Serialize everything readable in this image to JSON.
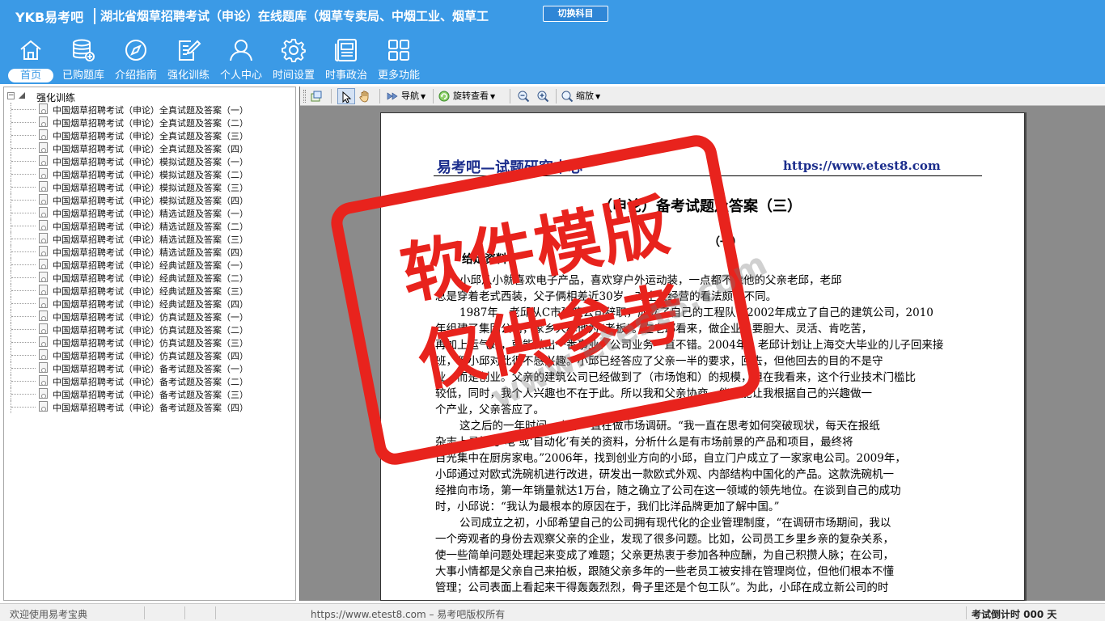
{
  "header": {
    "logo": "YKB易考吧",
    "title": "湖北省烟草招聘考试（申论）在线题库（烟草专卖局、中烟工业、烟草工",
    "switch_label": "切换科目"
  },
  "toolbar": [
    {
      "label": "首页",
      "icon": "home-icon",
      "active": true
    },
    {
      "label": "已购题库",
      "icon": "database-add-icon",
      "active": false
    },
    {
      "label": "介绍指南",
      "icon": "compass-icon",
      "active": false
    },
    {
      "label": "强化训练",
      "icon": "edit-document-icon",
      "active": false
    },
    {
      "label": "个人中心",
      "icon": "user-icon",
      "active": false
    },
    {
      "label": "时间设置",
      "icon": "gear-icon",
      "active": false
    },
    {
      "label": "时事政治",
      "icon": "news-icon",
      "active": false
    },
    {
      "label": "更多功能",
      "icon": "grid-icon",
      "active": false
    }
  ],
  "tree": {
    "root_label": "强化训练",
    "items": [
      "中国烟草招聘考试（申论）全真试题及答案（一）",
      "中国烟草招聘考试（申论）全真试题及答案（二）",
      "中国烟草招聘考试（申论）全真试题及答案（三）",
      "中国烟草招聘考试（申论）全真试题及答案（四）",
      "中国烟草招聘考试（申论）模拟试题及答案（一）",
      "中国烟草招聘考试（申论）模拟试题及答案（二）",
      "中国烟草招聘考试（申论）模拟试题及答案（三）",
      "中国烟草招聘考试（申论）模拟试题及答案（四）",
      "中国烟草招聘考试（申论）精选试题及答案（一）",
      "中国烟草招聘考试（申论）精选试题及答案（二）",
      "中国烟草招聘考试（申论）精选试题及答案（三）",
      "中国烟草招聘考试（申论）精选试题及答案（四）",
      "中国烟草招聘考试（申论）经典试题及答案（一）",
      "中国烟草招聘考试（申论）经典试题及答案（二）",
      "中国烟草招聘考试（申论）经典试题及答案（三）",
      "中国烟草招聘考试（申论）经典试题及答案（四）",
      "中国烟草招聘考试（申论）仿真试题及答案（一）",
      "中国烟草招聘考试（申论）仿真试题及答案（二）",
      "中国烟草招聘考试（申论）仿真试题及答案（三）",
      "中国烟草招聘考试（申论）仿真试题及答案（四）",
      "中国烟草招聘考试（申论）备考试题及答案（一）",
      "中国烟草招聘考试（申论）备考试题及答案（二）",
      "中国烟草招聘考试（申论）备考试题及答案（三）",
      "中国烟草招聘考试（申论）备考试题及答案（四）"
    ]
  },
  "viewer_toolbar": {
    "nav_label": "导航",
    "rotate_label": "旋转查看",
    "zoom_label": "缩放"
  },
  "document": {
    "header_left": "易考吧—试题研究中心",
    "header_right": "https://www.etest8.com",
    "title": "（申论）备考试题及答案（三）",
    "subtitle": "（一）",
    "section_head": "给定资料",
    "lines": [
      "小邱从小就喜欢电子产品，喜欢穿户外运动装，一点都不像他的父亲老邱，老邱",
      "总是穿着老式西装，父子俩相差近30岁，对企业经营的看法颇有不同。",
      "1987年，老邱从C市建筑公司辞职，成立了自己的工程队，2002年成立了自己的建筑公司，2010",
      "年组建了集团公司，家乡人称他为“老板”。在老邱看来，做企业只要胆大、灵活、肯吃苦，",
      "再加上运气好，就能做出一番事业。公司业务一直不错。2004年，老邱计划让上海交大毕业的儿子回来接",
      "班，但小邱对此很不感兴趣。小邱已经答应了父亲一半的要求，回去，但他回去的目的不是守",
      "业，而是创业。父亲的建筑公司已经做到了（市场饱和）的规模，但在我看来，这个行业技术门槛比",
      "较低，同时，我个人兴趣也不在于此。所以我和父亲协商，能不能让我根据自己的兴趣做一",
      "个产业，父亲答应了。",
      "这之后的一年时间，小邱一直在做市场调研。“我一直在思考如何突破现状，每天在报纸",
      "杂志上寻找与‘电’或‘自动化’有关的资料，分析什么是有市场前景的产品和项目，最终将",
      "目光集中在厨房家电。”2006年，找到创业方向的小邱，自立门户成立了一家家电公司。2009年，",
      "小邱通过对欧式洗碗机进行改进，研发出一款欧式外观、内部结构中国化的产品。这款洗碗机一",
      "经推向市场，第一年销量就达1万台，随之确立了公司在这一领域的领先地位。在谈到自己的成功",
      "时，小邱说：“我认为最根本的原因在于，我们比洋品牌更加了解中国。”",
      "公司成立之初，小邱希望自己的公司拥有现代化的企业管理制度，“在调研市场期间，我以",
      "一个旁观者的身份去观察父亲的企业，发现了很多问题。比如，公司员工乡里乡亲的复杂关系，",
      "使一些简单问题处理起来变成了难题；父亲更热衷于参加各种应酬，为自己积攒人脉；在公司，",
      "大事小情都是父亲自己来拍板，跟随父亲多年的一些老员工被安排在管理岗位，但他们根本不懂",
      "管理；公司表面上看起来干得轰轰烈烈，骨子里还是个包工队”。为此，小邱在成立新公司的时"
    ]
  },
  "watermark": {
    "line1": "软件模版",
    "line2": "仅供参考",
    "url": "www.etest8.com",
    "color": "#e8231d"
  },
  "status": {
    "left": "欢迎使用易考宝典",
    "middle": "https://www.etest8.com – 易考吧版权所有",
    "right": "考试倒计时 000 天"
  },
  "colors": {
    "header_bg": "#3b9ae6",
    "doc_header": "#1b2d8c"
  }
}
